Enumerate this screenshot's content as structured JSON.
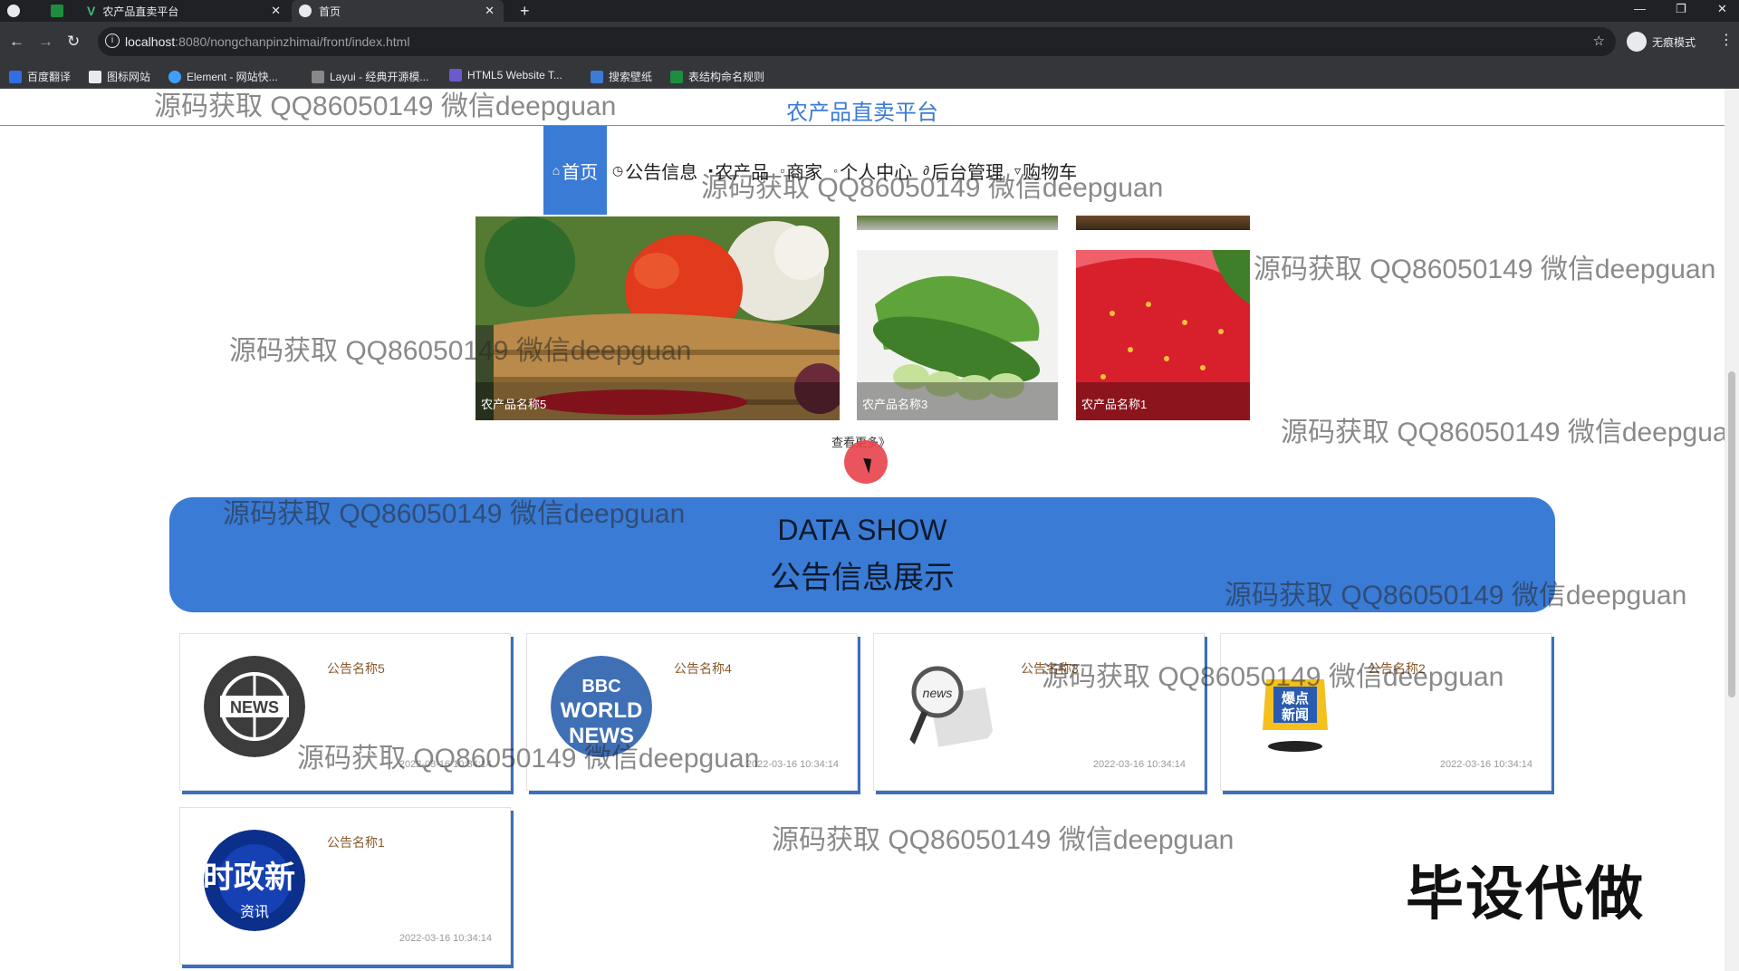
{
  "browser": {
    "tabs": [
      {
        "title": "农产品直卖平台"
      },
      {
        "title": "首页"
      }
    ],
    "url": {
      "host": "localhost",
      "rest": ":8080/nongchanpinzhimai/front/index.html"
    },
    "incognito_label": "无痕模式",
    "bookmarks": [
      "百度翻译",
      "图标网站",
      "Element - 网站快...",
      "Layui - 经典开源模...",
      "HTML5 Website T...",
      "搜索壁纸",
      "表结构命名规则"
    ]
  },
  "site": {
    "title": "农产品直卖平台"
  },
  "nav": {
    "items": [
      {
        "label": "首页",
        "icon": "home-icon"
      },
      {
        "label": "公告信息",
        "icon": "clock-icon"
      },
      {
        "label": "农产品",
        "icon": "grid-icon"
      },
      {
        "label": "商家",
        "icon": "store-icon"
      },
      {
        "label": "个人中心",
        "icon": "user-icon"
      },
      {
        "label": "后台管理",
        "icon": "link-icon"
      },
      {
        "label": "购物车",
        "icon": "cart-icon"
      }
    ]
  },
  "products": [
    {
      "name": "农产品名称5"
    },
    {
      "name": "农产品名称3"
    },
    {
      "name": "农产品名称1"
    }
  ],
  "more_link": "查看更多》",
  "banner": {
    "en": "DATA SHOW",
    "zh": "公告信息展示"
  },
  "notices": [
    {
      "title": "公告名称5",
      "date": "2022-03-16 10:34:14",
      "image": "news-globe-icon"
    },
    {
      "title": "公告名称4",
      "date": "2022-03-16 10:34:14",
      "image": "bbc-world-news-icon"
    },
    {
      "title": "公告名称3",
      "date": "2022-03-16 10:34:14",
      "image": "newspaper-magnifier-icon"
    },
    {
      "title": "公告名称2",
      "date": "2022-03-16 10:34:14",
      "image": "hot-news-icon"
    },
    {
      "title": "公告名称1",
      "date": "2022-03-16 10:34:14",
      "image": "politics-news-icon"
    }
  ],
  "watermark": "源码获取 QQ86050149 微信deepguan",
  "promo": "毕设代做",
  "colors": {
    "accent": "#3a7bd5",
    "chrome": "#202124"
  }
}
